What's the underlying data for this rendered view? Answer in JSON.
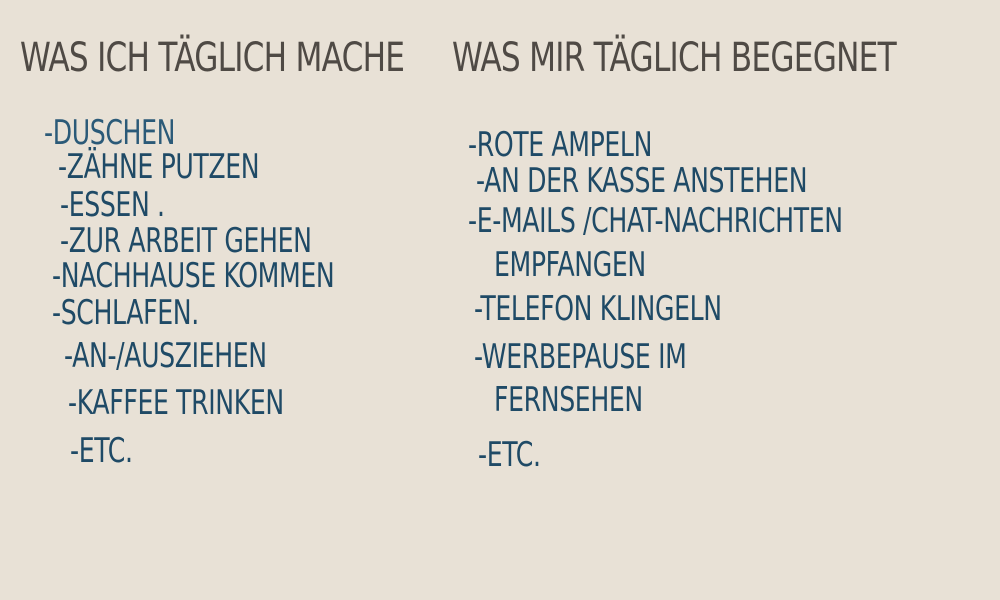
{
  "headings": {
    "left": "WAS ICH TÄGLICH MACHE",
    "right": "WAS MIR TÄGLICH BEGEGNET"
  },
  "left_list": [
    "-DUSCHEN",
    "-ZÄHNE PUTZEN",
    "-ESSEN .",
    "-ZUR ARBEIT GEHEN",
    "-NACHHAUSE KOMMEN",
    "-SCHLAFEN.",
    "-AN-/AUSZIEHEN",
    "-KAFFEE TRINKEN",
    "-ETC."
  ],
  "right_list": [
    "-ROTE AMPELN",
    "-AN DER KASSE ANSTEHEN",
    "-E-MAILS /CHAT-NACHRICHTEN",
    "EMPFANGEN",
    "-TELEFON KLINGELN",
    "-WERBEPAUSE IM",
    "FERNSEHEN",
    "-ETC."
  ],
  "colors": {
    "background": "#e8e1d6",
    "heading": "#4f4a45",
    "ink": "#1f4a66"
  }
}
